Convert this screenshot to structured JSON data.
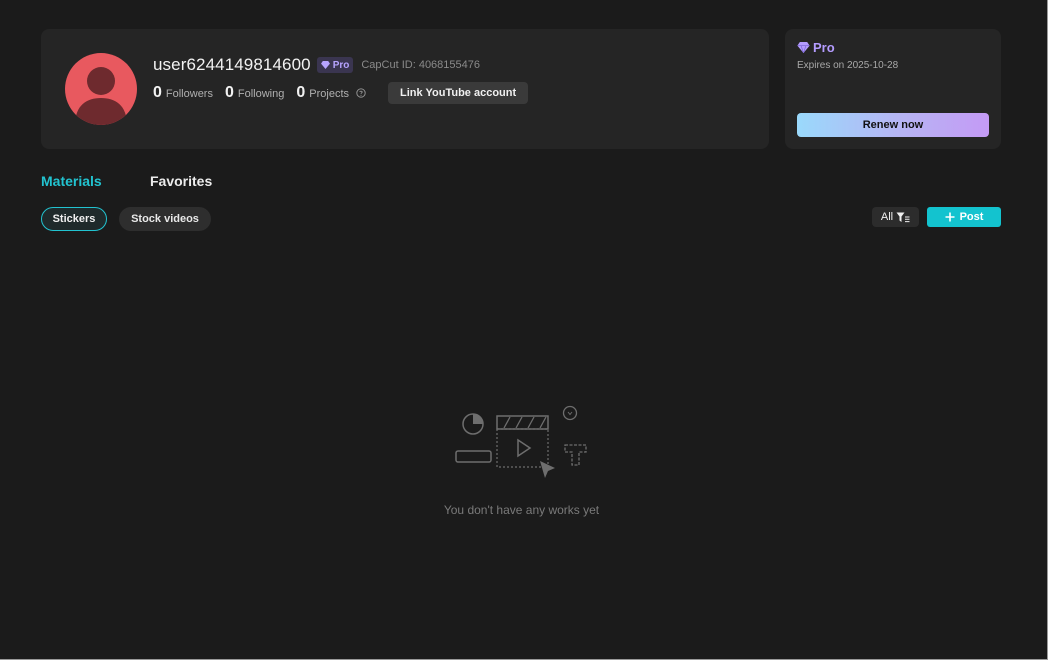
{
  "profile": {
    "username": "user6244149814600",
    "badge_label": "Pro",
    "capcut_id": "CapCut ID: 4068155476",
    "stats": [
      {
        "value": "0",
        "label": "Followers"
      },
      {
        "value": "0",
        "label": "Following"
      },
      {
        "value": "0",
        "label": "Projects"
      }
    ],
    "link_youtube_label": "Link YouTube account"
  },
  "pro_card": {
    "title": "Pro",
    "expiry": "Expires on 2025-10-28",
    "renew_label": "Renew now"
  },
  "tabs": [
    {
      "label": "Materials",
      "active": true
    },
    {
      "label": "Favorites",
      "active": false
    }
  ],
  "filters": {
    "chips": [
      {
        "label": "Stickers",
        "active": true
      },
      {
        "label": "Stock videos",
        "active": false
      }
    ],
    "dropdown_label": "All",
    "post_label": "Post"
  },
  "empty_state": {
    "message": "You don't have any works yet"
  },
  "colors": {
    "accent": "#22c3d0",
    "pro": "#b49cff",
    "avatar": "#e8595f",
    "background": "#1b1b1b"
  },
  "icons": [
    "avatar-placeholder-icon",
    "diamond-icon",
    "help-circle-icon",
    "filter-icon",
    "plus-icon",
    "empty-works-illustration"
  ]
}
